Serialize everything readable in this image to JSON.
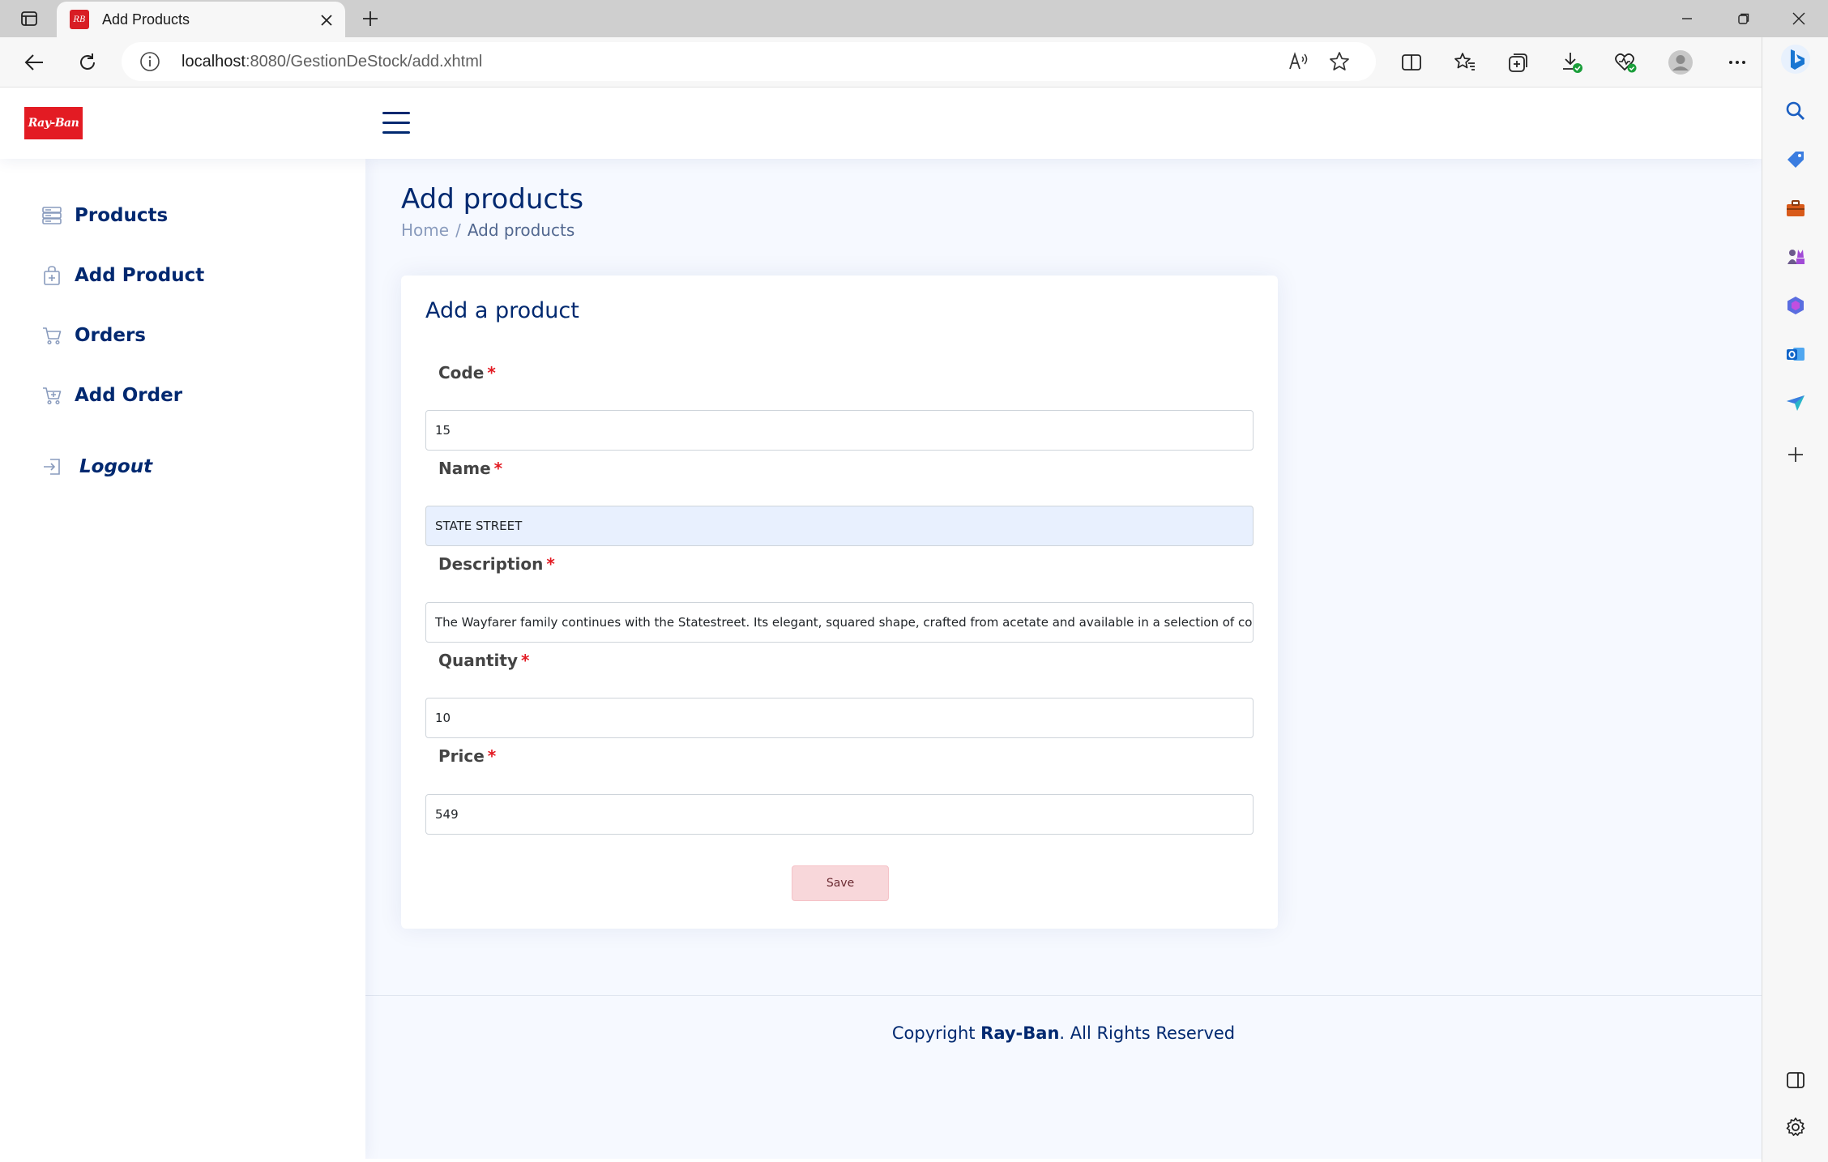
{
  "browser": {
    "tab_title": "Add Products",
    "address_host": "localhost",
    "address_path": ":8080/GestionDeStock/add.xhtml"
  },
  "app": {
    "logo_text": "Ray-Ban",
    "brand_color": "#e31b23",
    "accent_color": "#012970"
  },
  "sidebar": {
    "items": [
      {
        "label": "Products",
        "icon": "server-icon"
      },
      {
        "label": "Add Product",
        "icon": "bag-plus-icon"
      },
      {
        "label": "Orders",
        "icon": "cart-icon"
      },
      {
        "label": "Add Order",
        "icon": "cart-plus-icon"
      }
    ],
    "logout_label": "Logout"
  },
  "header": {
    "page_title": "Add products",
    "breadcrumb": [
      "Home",
      "Add products"
    ]
  },
  "form": {
    "card_title": "Add a product",
    "required_marker": "*",
    "fields": [
      {
        "label": "Code",
        "value": "15"
      },
      {
        "label": "Name",
        "value": "STATE STREET"
      },
      {
        "label": "Description",
        "value": "The Wayfarer family continues with the Statestreet. Its elegant, squared shape, crafted from acetate and available in a selection of colours, crea"
      },
      {
        "label": "Quantity",
        "value": "10"
      },
      {
        "label": "Price",
        "value": "549"
      }
    ],
    "save_label": "Save"
  },
  "footer": {
    "prefix": "Copyright ",
    "brand": "Ray-Ban",
    "suffix": ". All Rights Reserved"
  }
}
